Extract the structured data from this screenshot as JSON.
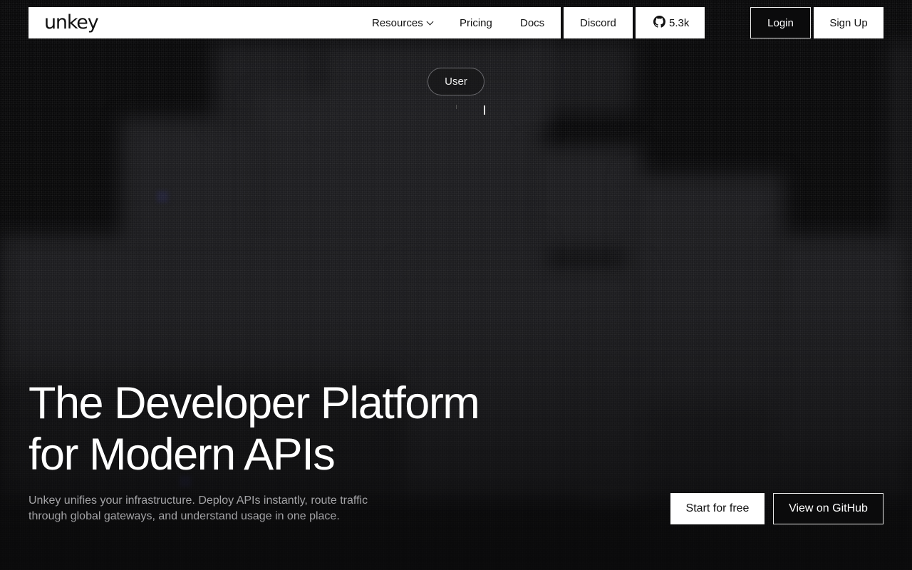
{
  "nav": {
    "logo": "unkey",
    "resources_label": "Resources",
    "pricing_label": "Pricing",
    "docs_label": "Docs",
    "discord_label": "Discord",
    "github_stars": "5.3k",
    "login_label": "Login",
    "signup_label": "Sign Up"
  },
  "badge": {
    "label": "User"
  },
  "hero": {
    "title_line1": "The Developer Platform",
    "title_line2": "for Modern APIs",
    "subtitle_line1": "Unkey unifies your infrastructure. Deploy APIs instantly, route traffic",
    "subtitle_line2": "through global gateways, and understand usage in one place.",
    "cta_primary": "Start for free",
    "cta_secondary": "View on GitHub"
  },
  "colors": {
    "background": "#0b0b0c",
    "surface": "#ffffff",
    "text_muted": "#a3a3a6"
  }
}
